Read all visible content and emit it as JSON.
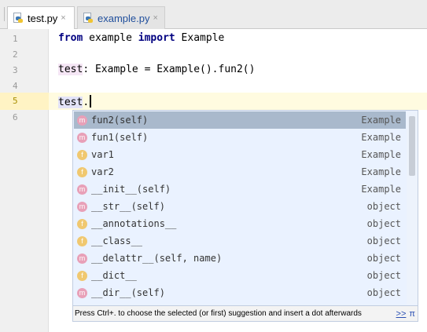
{
  "tabs": [
    {
      "label": "test.py",
      "active": true,
      "icon": "python-file-icon"
    },
    {
      "label": "example.py",
      "active": false,
      "icon": "python-file-icon"
    }
  ],
  "close_glyph": "×",
  "line_numbers": [
    "1",
    "2",
    "3",
    "4",
    "5",
    "6"
  ],
  "code": {
    "line1": {
      "kw1": "from",
      "mod": " example ",
      "kw2": "import",
      "rest": " Example"
    },
    "line3": {
      "ident": "test",
      "rest": ": Example = Example().fun2()"
    },
    "line5": {
      "ident": "test",
      "rest": "."
    }
  },
  "completion": {
    "items": [
      {
        "kind": "m",
        "name": "fun2(self)",
        "type": "Example"
      },
      {
        "kind": "m",
        "name": "fun1(self)",
        "type": "Example"
      },
      {
        "kind": "f",
        "name": "var1",
        "type": "Example"
      },
      {
        "kind": "f",
        "name": "var2",
        "type": "Example"
      },
      {
        "kind": "m",
        "name": "__init__(self)",
        "type": "Example"
      },
      {
        "kind": "m",
        "name": "__str__(self)",
        "type": "object"
      },
      {
        "kind": "f",
        "name": "__annotations__",
        "type": "object"
      },
      {
        "kind": "f",
        "name": "__class__",
        "type": "object"
      },
      {
        "kind": "m",
        "name": "__delattr__(self, name)",
        "type": "object"
      },
      {
        "kind": "f",
        "name": "__dict__",
        "type": "object"
      },
      {
        "kind": "m",
        "name": "__dir__(self)",
        "type": "object"
      }
    ],
    "selected_index": 0,
    "footer_hint": "Press Ctrl+. to choose the selected (or first) suggestion and insert a dot afterwards",
    "footer_link": ">>",
    "footer_pi": "π"
  },
  "colors": {
    "keyword": "#000080",
    "selected_row": "#a9b9cc",
    "popup_bg": "#eaf2ff",
    "method_badge": "#e8a0b8",
    "field_badge": "#f0c870"
  }
}
